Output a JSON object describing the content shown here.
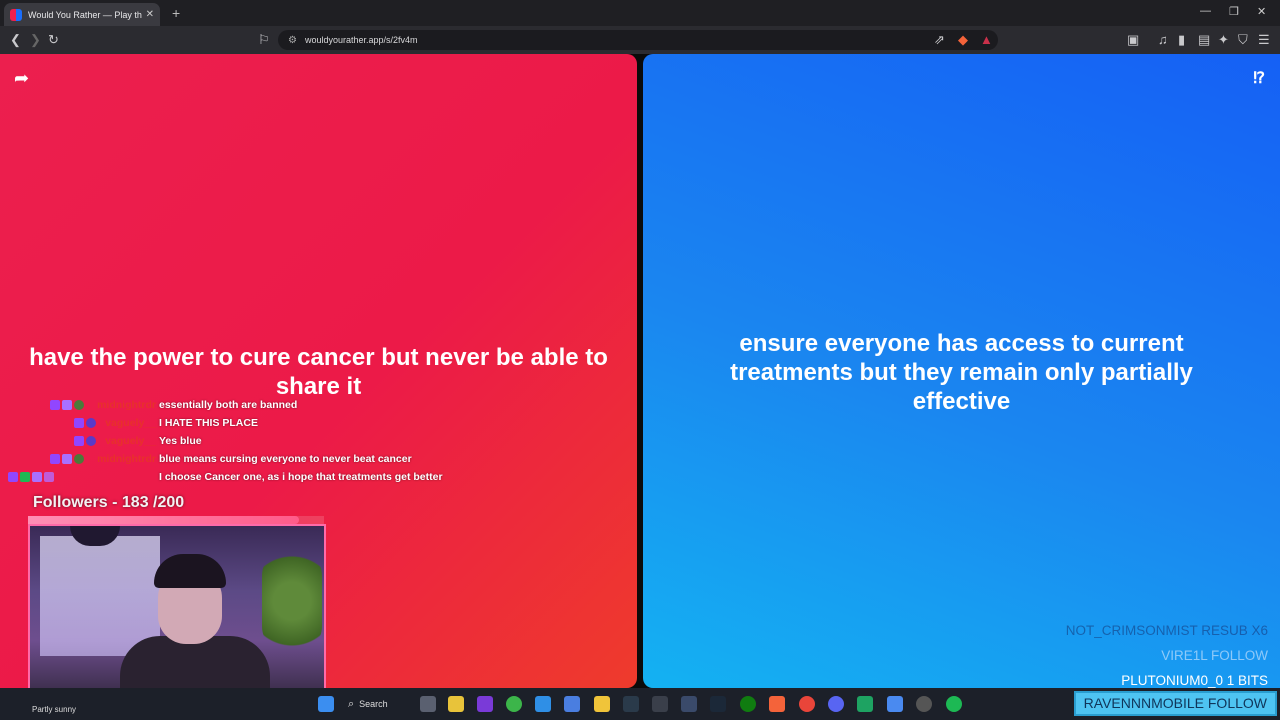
{
  "browser": {
    "tab_title": "Would You Rather — Play the O",
    "url": "wouldyourather.app/s/2fv4m"
  },
  "options": {
    "left": "have the power to cure cancer but never be able to share it",
    "right": "ensure everyone has access to current treatments but they remain only partially effective"
  },
  "chat": [
    {
      "user": "midnightrdr",
      "user_color": "red",
      "message": "essentially both are banned"
    },
    {
      "user": "vaguely__",
      "user_color": "red",
      "message": "I HATE THIS PLACE"
    },
    {
      "user": "vaguely__",
      "user_color": "red",
      "message": "Yes blue"
    },
    {
      "user": "midnightrdr",
      "user_color": "red",
      "message": "blue means cursing everyone to never beat cancer"
    },
    {
      "user": "",
      "user_color": "red",
      "message": "I choose Cancer one, as i hope that treatments get better"
    }
  ],
  "followers": {
    "label": "Followers - 183 /200",
    "current": 183,
    "goal": 200
  },
  "alerts": {
    "line1": "NOT_CRIMSONMIST  RESUB X6",
    "line2": "VIRE1L  FOLLOW",
    "line3": "PLUTONIUM0_0  1 BITS",
    "boxed": "RAVENNNMOBILE  FOLLOW"
  },
  "taskbar": {
    "weather": "Partly sunny",
    "search_label": "Search"
  },
  "colors": {
    "red_panel": "#ec1f4e",
    "blue_panel": "#1a7ff2"
  }
}
